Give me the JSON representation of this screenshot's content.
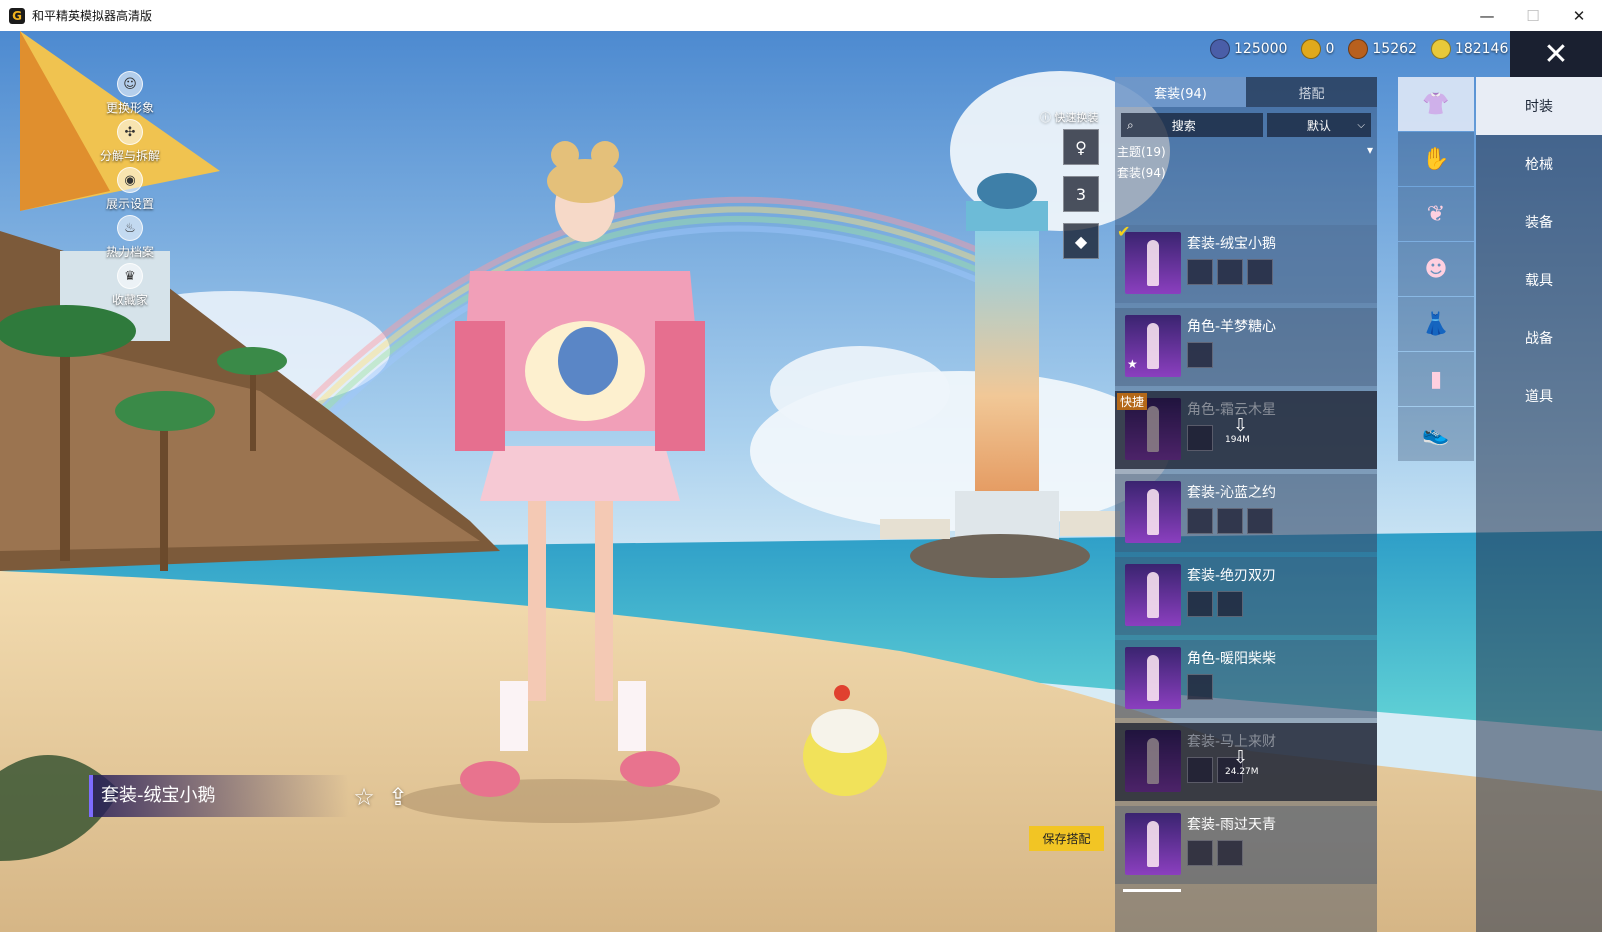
{
  "window": {
    "title": "和平精英模拟器高清版",
    "minimize": "—",
    "maximize": "☐",
    "close": "✕"
  },
  "left_menu": [
    {
      "label": "更换形象",
      "icon": "person-icon"
    },
    {
      "label": "分解与拆解",
      "icon": "disassemble-icon"
    },
    {
      "label": "展示设置",
      "icon": "eye-icon"
    },
    {
      "label": "热力档案",
      "icon": "heat-icon"
    },
    {
      "label": "收藏家",
      "icon": "trophy-icon"
    }
  ],
  "current_outfit": {
    "name": "套装-绒宝小鹅"
  },
  "currency": [
    {
      "value": "125000",
      "color": "#4a5ea8",
      "icon": "gem-coin-icon"
    },
    {
      "value": "0",
      "color": "#e0a91c",
      "icon": "a-coin-icon"
    },
    {
      "value": "15262",
      "color": "#b8601e",
      "icon": "bronze-coin-icon"
    },
    {
      "value": "182146",
      "color": "#e8c93a",
      "icon": "gold-coin-icon"
    }
  ],
  "quick_change": {
    "label": "快速换装",
    "slots": [
      "figure-icon",
      "3",
      "diamond-icon"
    ]
  },
  "panel": {
    "tabs": [
      {
        "label": "套装(94)"
      },
      {
        "label": "搭配"
      }
    ],
    "search_placeholder": "搜索",
    "sort_label": "默认",
    "theme_header": "主题(19)",
    "set_header": "套装(94)",
    "items": [
      {
        "title": "套装-绒宝小鹅",
        "parts": 3,
        "state": "selected",
        "checked": true
      },
      {
        "title": "角色-羊梦糖心",
        "parts": 1,
        "state": "normal",
        "starred": true
      },
      {
        "title": "角色-霜云木星",
        "parts": 1,
        "state": "locked",
        "quick": "快捷",
        "download": "194M"
      },
      {
        "title": "套装-沁蓝之约",
        "parts": 3,
        "state": "normal"
      },
      {
        "title": "套装-绝刃双刃",
        "parts": 2,
        "state": "normal"
      },
      {
        "title": "角色-暖阳柴柴",
        "parts": 1,
        "state": "normal"
      },
      {
        "title": "套装-马上来财",
        "parts": 2,
        "state": "locked",
        "download": "24.27M"
      },
      {
        "title": "套装-雨过天青",
        "parts": 2,
        "state": "normal"
      }
    ]
  },
  "save_button": "保存搭配",
  "subcategories": [
    "top-icon",
    "glove-icon",
    "accessory-icon",
    "mask-icon",
    "outfit-icon",
    "pants-icon",
    "shoes-icon"
  ],
  "main_categories": [
    {
      "label": "时装",
      "active": true
    },
    {
      "label": "枪械"
    },
    {
      "label": "装备"
    },
    {
      "label": "载具"
    },
    {
      "label": "战备"
    },
    {
      "label": "道具"
    }
  ]
}
